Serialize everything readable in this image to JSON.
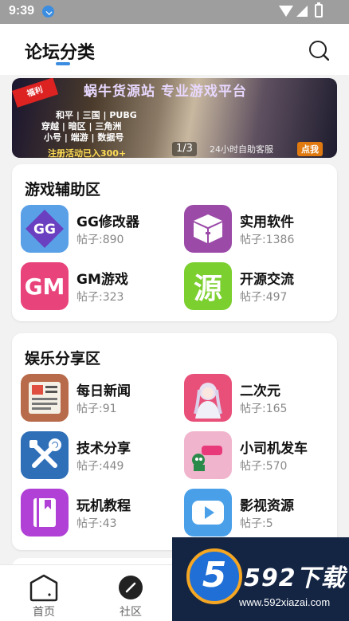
{
  "status": {
    "time": "9:39"
  },
  "header": {
    "title": "论坛分类"
  },
  "banner": {
    "top_text": "蜗牛货源站 专业游戏平台",
    "corner_tag": "福利",
    "line1": "和平 | 三国 | PUBG",
    "line2": "穿越 | 暗区 | 三角洲",
    "line3": "小号 | 端游 | 数据号",
    "bottom_left": "注册活动已入300+",
    "bottom_right": "24小时自助客服",
    "button": "点我",
    "pager": "1/3"
  },
  "sections": [
    {
      "title": "游戏辅助区",
      "items": [
        {
          "name": "GG修改器",
          "count": "帖子:890",
          "icon": "gg-modifier-icon",
          "glyph": "GG",
          "bg": "#5aa0e6",
          "fg": "#6a3fc0"
        },
        {
          "name": "实用软件",
          "count": "帖子:1386",
          "icon": "box-icon",
          "glyph": "",
          "bg": "#9b4aa8",
          "fg": "#ffffff"
        },
        {
          "name": "GM游戏",
          "count": "帖子:323",
          "icon": "gm-icon",
          "glyph": "GM",
          "bg": "#e8437a",
          "fg": "#ffffff"
        },
        {
          "name": "开源交流",
          "count": "帖子:497",
          "icon": "source-icon",
          "glyph": "源",
          "bg": "#7bcf2e",
          "fg": "#ffffff"
        }
      ]
    },
    {
      "title": "娱乐分享区",
      "items": [
        {
          "name": "每日新闻",
          "count": "帖子:91",
          "icon": "newspaper-icon",
          "glyph": "",
          "bg": "#b86b4a",
          "fg": "#ffffff"
        },
        {
          "name": "二次元",
          "count": "帖子:165",
          "icon": "anime-girl-icon",
          "glyph": "",
          "bg": "#e8507a",
          "fg": "#ffffff"
        },
        {
          "name": "技术分享",
          "count": "帖子:449",
          "icon": "tools-icon",
          "glyph": "",
          "bg": "#2f6fb8",
          "fg": "#ffffff"
        },
        {
          "name": "小司机发车",
          "count": "帖子:570",
          "icon": "driver-icon",
          "glyph": "",
          "bg": "#f0b5cc",
          "fg": "#2a8a4a"
        },
        {
          "name": "玩机教程",
          "count": "帖子:43",
          "icon": "book-icon",
          "glyph": "",
          "bg": "#b040d6",
          "fg": "#ffffff"
        },
        {
          "name": "影视资源",
          "count": "帖子:5",
          "icon": "video-play-icon",
          "glyph": "",
          "bg": "#4aa0e8",
          "fg": "#ffffff"
        }
      ]
    }
  ],
  "tabbar": [
    {
      "label": "首页",
      "icon": "home-icon"
    },
    {
      "label": "社区",
      "icon": "compass-icon"
    }
  ],
  "watermark": {
    "logo": "5",
    "title": "592下载",
    "url": "www.592xiazai.com"
  }
}
